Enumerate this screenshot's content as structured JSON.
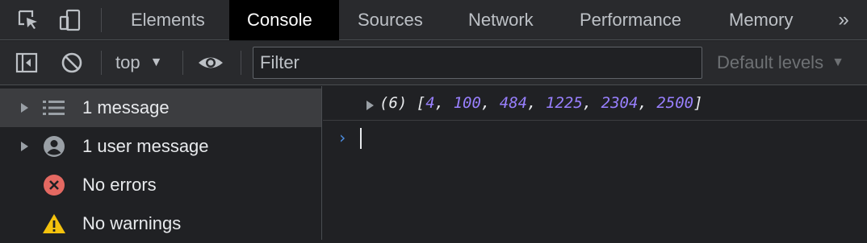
{
  "tabs": [
    "Elements",
    "Console",
    "Sources",
    "Network",
    "Performance",
    "Memory"
  ],
  "active_tab": "Console",
  "toolbar": {
    "context": "top",
    "filter_placeholder": "Filter",
    "levels": "Default levels"
  },
  "sidebar": {
    "items": [
      {
        "label": "1 message",
        "icon": "list-icon"
      },
      {
        "label": "1 user message",
        "icon": "user-icon"
      },
      {
        "label": "No errors",
        "icon": "error-icon"
      },
      {
        "label": "No warnings",
        "icon": "warning-icon"
      }
    ]
  },
  "console": {
    "output": {
      "length_label": "(6)",
      "values": [
        "4",
        "100",
        "484",
        "1225",
        "2304",
        "2500"
      ]
    },
    "prompt": "›"
  },
  "colors": {
    "accent": "#4d8fe3",
    "number": "#9980ff",
    "error": "#e46962",
    "warning": "#f4c20d"
  }
}
